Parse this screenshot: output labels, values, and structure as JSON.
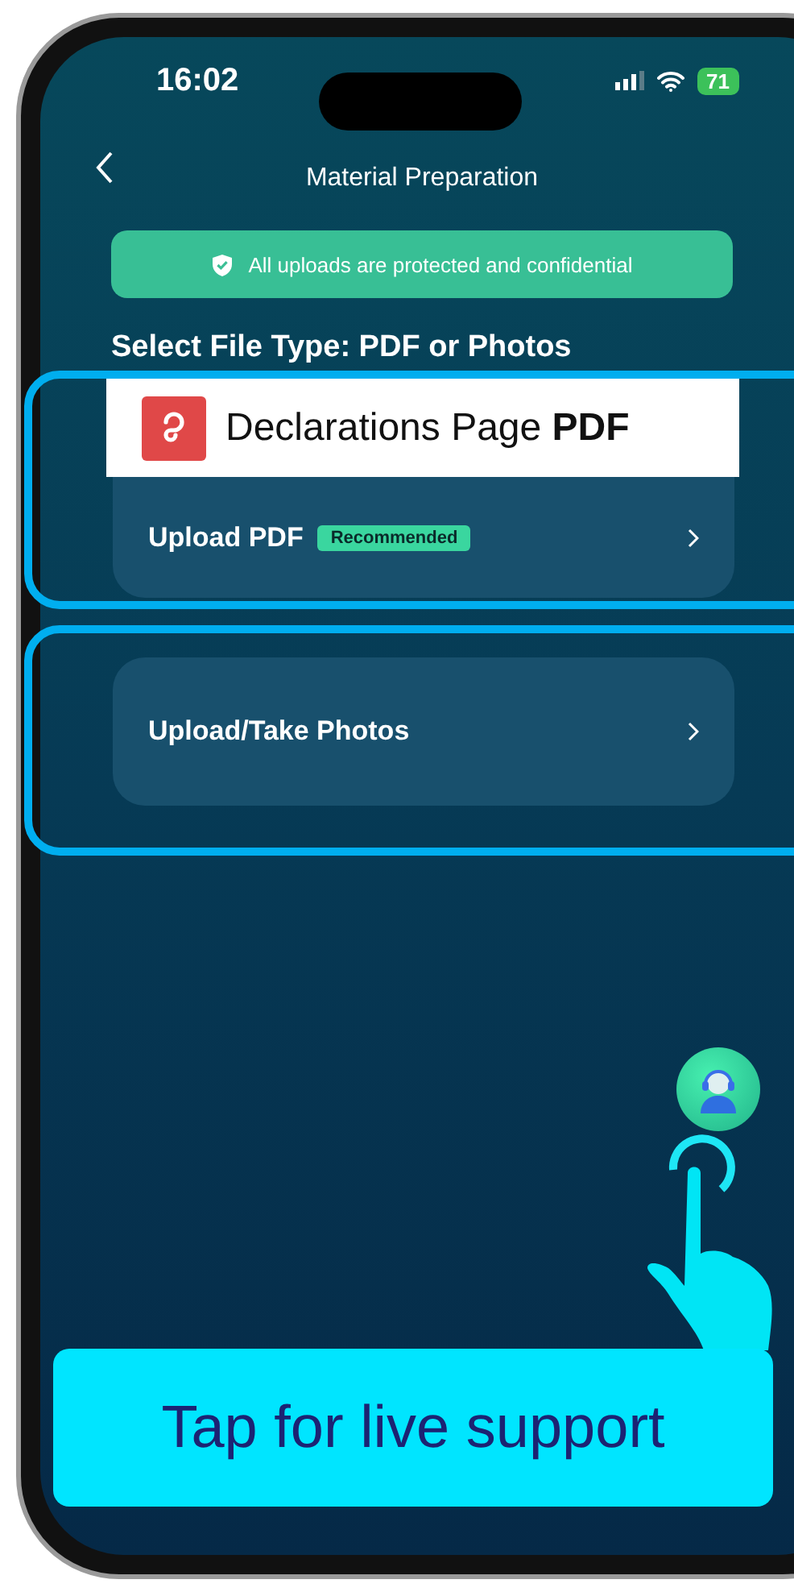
{
  "status_bar": {
    "time": "16:02",
    "battery": "71"
  },
  "header": {
    "title": "Material Preparation"
  },
  "notice": {
    "text": "All uploads are protected and confidential"
  },
  "section_title": "Select File Type: PDF or Photos",
  "callout": {
    "text": "Declarations Page **PDF**"
  },
  "options": [
    {
      "label": "Upload PDF",
      "badge": "Recommended",
      "highlighted": true
    },
    {
      "label": "Upload/Take Photos",
      "highlighted": true
    }
  ],
  "banner": {
    "text": "Tap for live support"
  }
}
